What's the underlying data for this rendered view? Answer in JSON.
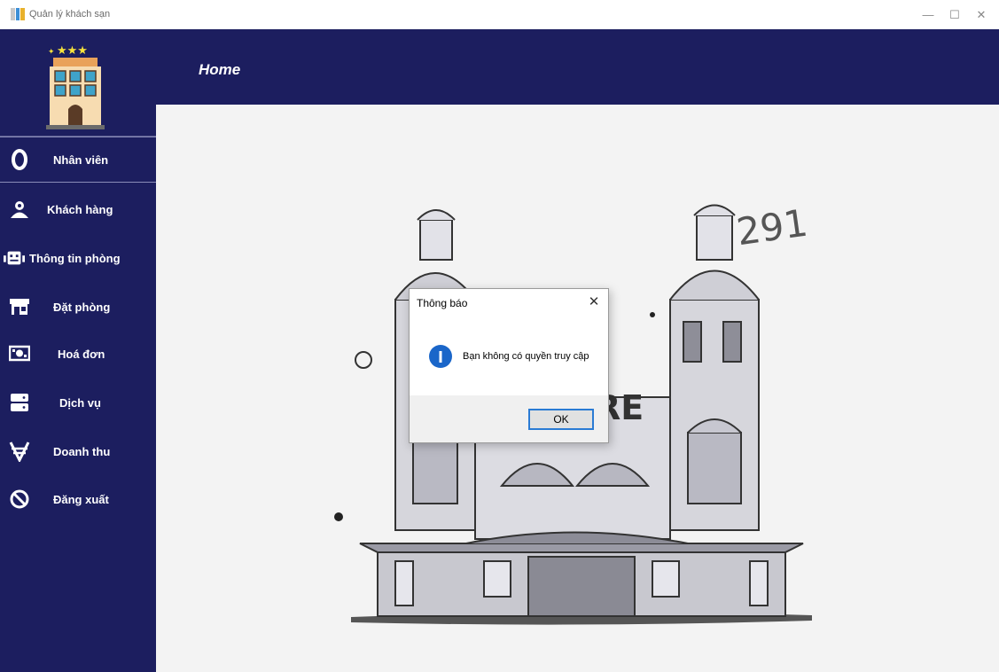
{
  "window": {
    "title": "Quản lý khách sạn",
    "minimize": "—",
    "maximize": "☐",
    "close": "✕"
  },
  "header": {
    "title": "Home"
  },
  "sidebar": {
    "items": [
      {
        "label": "Nhân viên",
        "icon": "ring-icon"
      },
      {
        "label": "Khách hàng",
        "icon": "people-icon"
      },
      {
        "label": "Thông tin phòng",
        "icon": "robot-icon"
      },
      {
        "label": "Đặt phòng",
        "icon": "store-icon"
      },
      {
        "label": "Hoá đơn",
        "icon": "money-icon"
      },
      {
        "label": "Dịch vụ",
        "icon": "server-icon"
      },
      {
        "label": "Doanh thu",
        "icon": "currency-icon"
      },
      {
        "label": "Đăng xuất",
        "icon": "ban-icon"
      }
    ]
  },
  "illustration": {
    "number": "291",
    "sign": "RE"
  },
  "dialog": {
    "title": "Thông báo",
    "message": "Bạn không có quyền truy cập",
    "ok_label": "OK",
    "close_glyph": "✕"
  },
  "colors": {
    "navy": "#1c1e5f",
    "accent": "#1a66c9"
  }
}
